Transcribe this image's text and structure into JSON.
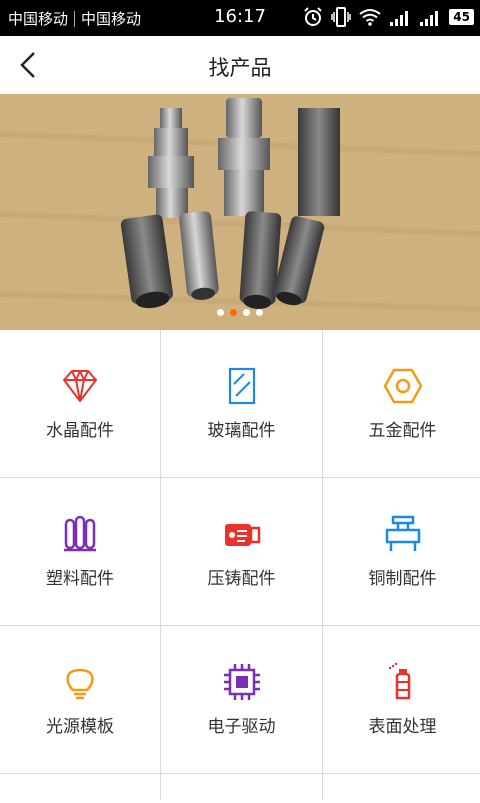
{
  "status_bar": {
    "carrier1": "中国移动",
    "carrier2": "中国移动",
    "time": "16:17",
    "battery": "45",
    "icons": [
      "alarm-icon",
      "vibrate-icon",
      "wifi-icon",
      "signal-icon",
      "signal-icon",
      "battery-icon"
    ]
  },
  "header": {
    "title": "找产品",
    "back_icon": "back-chevron-icon"
  },
  "banner": {
    "slide_count": 4,
    "active_slide": 2,
    "colors": {
      "background": "#cfb07f",
      "active_dot": "#ff6a00",
      "dot": "#ffffff"
    }
  },
  "categories": [
    {
      "label": "水晶配件",
      "icon": "diamond-icon",
      "color": "#e8322a"
    },
    {
      "label": "玻璃配件",
      "icon": "glass-pane-icon",
      "color": "#1e88e5"
    },
    {
      "label": "五金配件",
      "icon": "hex-nut-icon",
      "color": "#f39c12"
    },
    {
      "label": "塑料配件",
      "icon": "plastic-rolls-icon",
      "color": "#7b2fb8"
    },
    {
      "label": "压铸配件",
      "icon": "die-casting-icon",
      "color": "#e8322a"
    },
    {
      "label": "铜制配件",
      "icon": "copper-fitting-icon",
      "color": "#1e88e5"
    },
    {
      "label": "光源模板",
      "icon": "light-bulb-icon",
      "color": "#f39c12"
    },
    {
      "label": "电子驱动",
      "icon": "chip-icon",
      "color": "#7b2fb8"
    },
    {
      "label": "表面处理",
      "icon": "spray-bottle-icon",
      "color": "#e8322a"
    }
  ]
}
